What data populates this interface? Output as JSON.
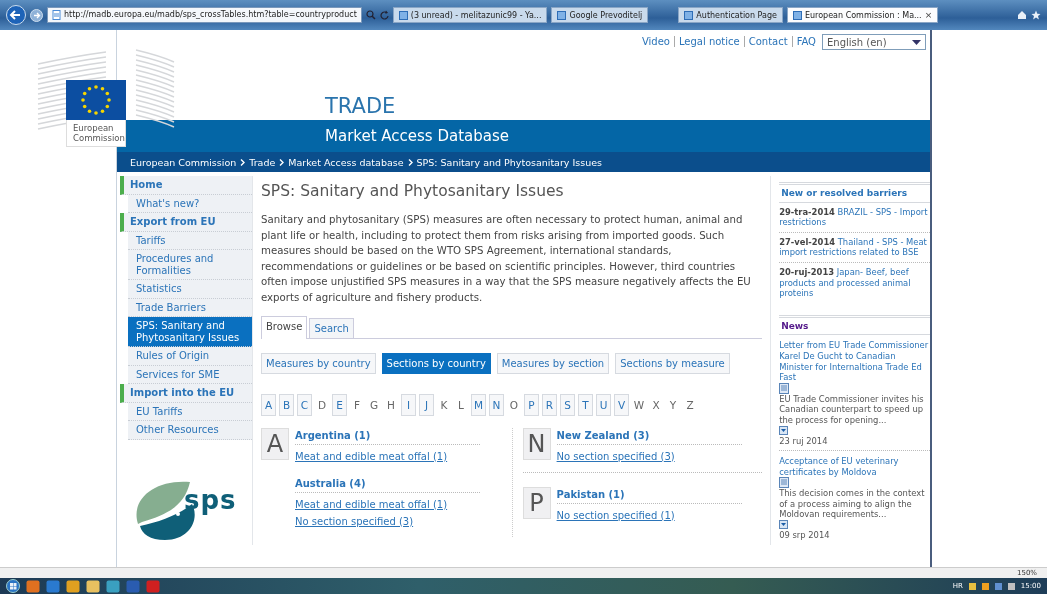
{
  "browser": {
    "address": "http://madb.europa.eu/madb/sps_crossTables.htm?table=countryproduct",
    "tabs": [
      {
        "title": "(3 unread) - melitazunic99 - Ya...",
        "selected": false
      },
      {
        "title": "Google Prevoditelj",
        "selected": false
      },
      {
        "title": "Authentication Page",
        "selected": false
      },
      {
        "title": "European Commission : Ma...",
        "selected": true
      }
    ],
    "close_tab": "×",
    "zoom": "150%"
  },
  "header": {
    "top_links": [
      "Video",
      "Legal notice",
      "Contact",
      "FAQ"
    ],
    "language": "English (en)",
    "logo_text": "European Commission",
    "site_title": "TRADE",
    "subtitle": "Market Access Database",
    "breadcrumb": [
      "European Commission",
      "Trade",
      "Market Access database",
      "SPS: Sanitary and Phytosanitary Issues"
    ]
  },
  "sidebar": {
    "items": [
      {
        "label": "Home",
        "kind": "section",
        "selected": false
      },
      {
        "label": "What's new?",
        "kind": "item",
        "selected": false
      },
      {
        "label": "Export from EU",
        "kind": "section",
        "selected": false
      },
      {
        "label": "Tariffs",
        "kind": "item",
        "selected": false
      },
      {
        "label": "Procedures and Formalities",
        "kind": "item",
        "selected": false
      },
      {
        "label": "Statistics",
        "kind": "item",
        "selected": false
      },
      {
        "label": "Trade Barriers",
        "kind": "item",
        "selected": false
      },
      {
        "label": "SPS: Sanitary and Phytosanitary Issues",
        "kind": "item",
        "selected": true
      },
      {
        "label": "Rules of Origin",
        "kind": "item",
        "selected": false
      },
      {
        "label": "Services for SME",
        "kind": "item",
        "selected": false
      },
      {
        "label": "Import into the EU",
        "kind": "section",
        "selected": false
      },
      {
        "label": "EU Tariffs",
        "kind": "item",
        "selected": false
      },
      {
        "label": "Other Resources",
        "kind": "item",
        "selected": false
      }
    ],
    "logo_text": "sps"
  },
  "main": {
    "title": "SPS: Sanitary and Phytosanitary Issues",
    "intro": "Sanitary and phytosanitary (SPS) measures are often necessary to protect human, animal and plant life or health, including to protect them from risks arising from imported goods. Such measures should be based on the WTO SPS Agreement, international standards, recommendations or guidelines or be based on scientific principles. However, third countries often impose unjustified SPS measures in a way that the SPS measure negatively affects the EU exports of agriculture and fishery products.",
    "tabs": [
      {
        "label": "Browse",
        "selected": true
      },
      {
        "label": "Search",
        "selected": false
      }
    ],
    "views": [
      {
        "label": "Measures by country",
        "selected": false
      },
      {
        "label": "Sections by country",
        "selected": true
      },
      {
        "label": "Measures by section",
        "selected": false
      },
      {
        "label": "Sections by measure",
        "selected": false
      }
    ],
    "letters": [
      {
        "letter": "A",
        "enabled": true
      },
      {
        "letter": "B",
        "enabled": true
      },
      {
        "letter": "C",
        "enabled": true
      },
      {
        "letter": "D",
        "enabled": false
      },
      {
        "letter": "E",
        "enabled": true
      },
      {
        "letter": "F",
        "enabled": false
      },
      {
        "letter": "G",
        "enabled": false
      },
      {
        "letter": "H",
        "enabled": false
      },
      {
        "letter": "I",
        "enabled": true
      },
      {
        "letter": "J",
        "enabled": true
      },
      {
        "letter": "K",
        "enabled": false
      },
      {
        "letter": "L",
        "enabled": false
      },
      {
        "letter": "M",
        "enabled": true
      },
      {
        "letter": "N",
        "enabled": true
      },
      {
        "letter": "O",
        "enabled": false
      },
      {
        "letter": "P",
        "enabled": true
      },
      {
        "letter": "R",
        "enabled": true
      },
      {
        "letter": "S",
        "enabled": true
      },
      {
        "letter": "T",
        "enabled": true
      },
      {
        "letter": "U",
        "enabled": true
      },
      {
        "letter": "V",
        "enabled": true
      },
      {
        "letter": "W",
        "enabled": false
      },
      {
        "letter": "X",
        "enabled": false
      },
      {
        "letter": "Y",
        "enabled": false
      },
      {
        "letter": "Z",
        "enabled": false
      }
    ],
    "columns": [
      [
        {
          "letter": "A",
          "countries": [
            {
              "name": "Argentina (1)",
              "sections": [
                "Meat and edible meat offal (1)"
              ]
            },
            {
              "name": "Australia (4)",
              "sections": [
                "Meat and edible meat offal (1)",
                "No section specified (3)"
              ]
            }
          ]
        }
      ],
      [
        {
          "letter": "N",
          "countries": [
            {
              "name": "New Zealand (3)",
              "sections": [
                "No section specified (3)"
              ]
            }
          ]
        },
        {
          "letter": "P",
          "countries": [
            {
              "name": "Pakistan (1)",
              "sections": [
                "No section specified (1)"
              ]
            }
          ]
        }
      ]
    ]
  },
  "aside": {
    "barriers_title": "New or resolved barriers",
    "barriers": [
      {
        "date": "29-tra-2014",
        "title": "BRAZIL - SPS - Import restrictions"
      },
      {
        "date": "27-vel-2014",
        "title": "Thailand - SPS - Meat import restrictions related to BSE"
      },
      {
        "date": "20-ruj-2013",
        "title": "Japan- Beef, beef products and processed animal proteins"
      }
    ],
    "news_title": "News",
    "news": [
      {
        "title": "Letter from EU Trade Commissioner Karel De Gucht to Canadian Minister for Internaltiona Trade Ed Fast",
        "summary": "EU Trade Commissioner invites his Canadian counterpart to speed up the process for opening...",
        "date": "23 ruj 2014"
      },
      {
        "title": "Acceptance of EU veterinary certificates by Moldova",
        "summary": "This decision comes in the context of a process aiming to align the Moldovan requirements...",
        "date": "09 srp 2014"
      }
    ]
  },
  "taskbar": {
    "language": "HR",
    "time": "15:00"
  }
}
